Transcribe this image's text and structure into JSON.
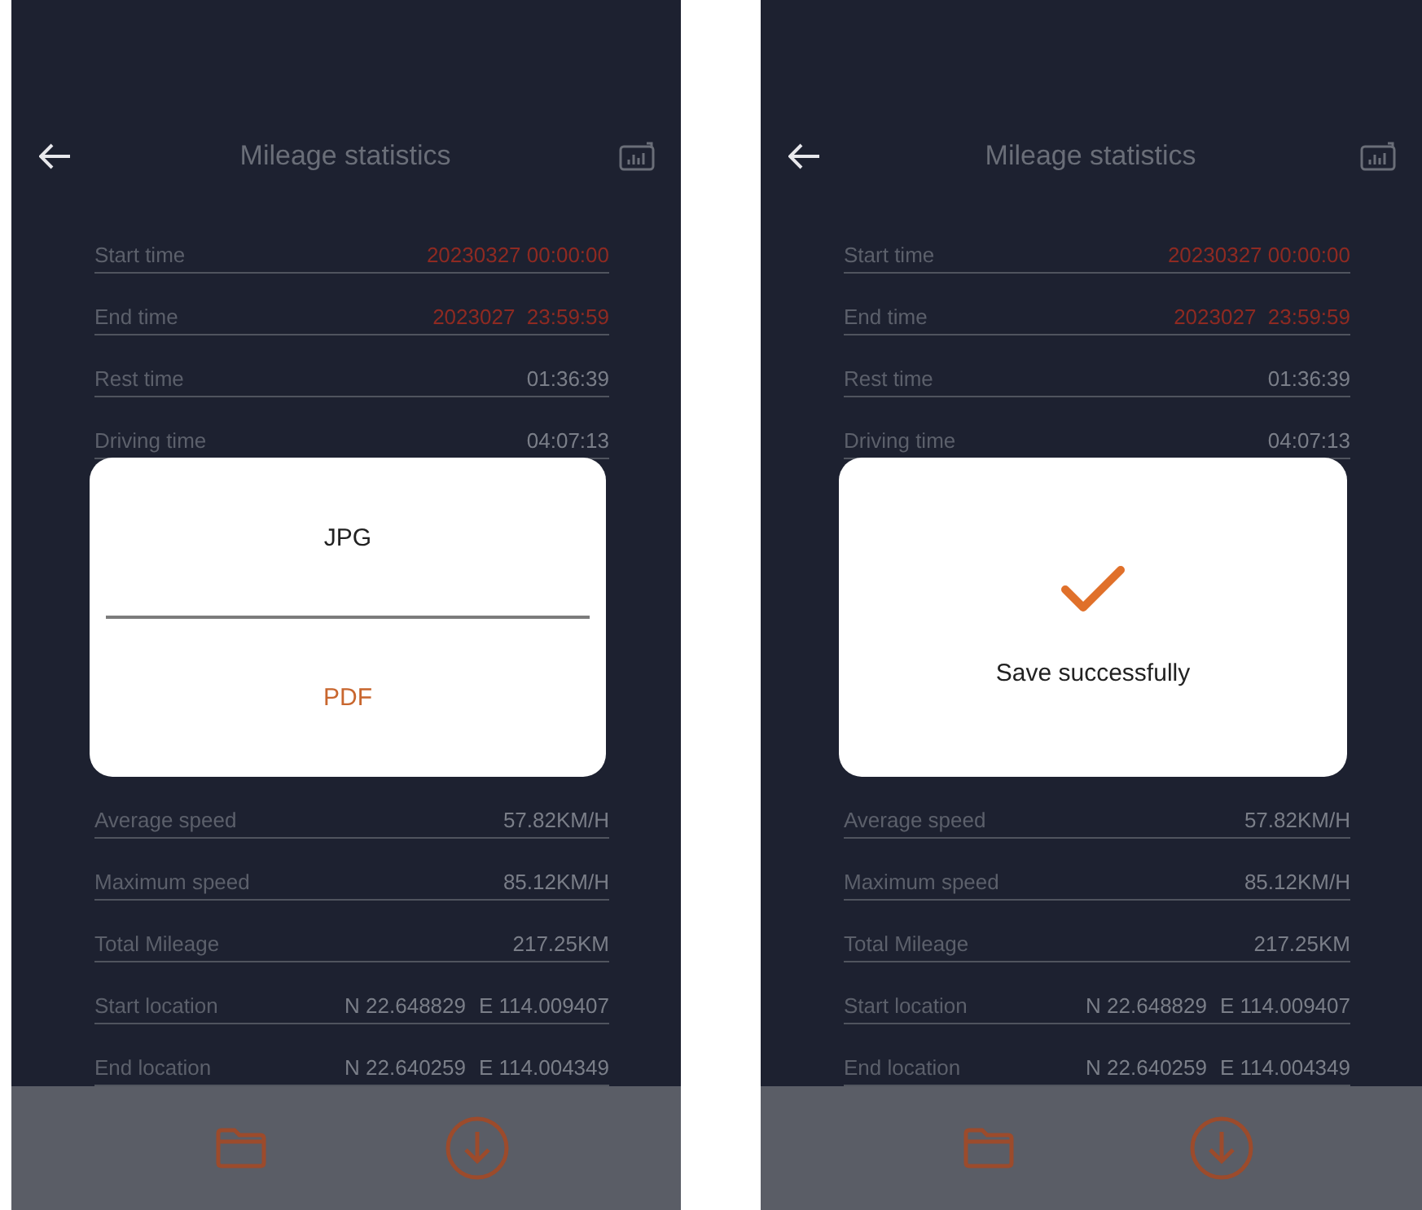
{
  "screens": [
    {
      "title": "Mileage statistics",
      "rows": [
        {
          "label": "Start time",
          "values": [
            "20230327 00:00:00"
          ],
          "highlighted": true
        },
        {
          "label": "End time",
          "values": [
            "2023027  23:59:59"
          ],
          "highlighted": true
        },
        {
          "label": "Rest time",
          "values": [
            "01:36:39"
          ],
          "highlighted": false
        },
        {
          "label": "Driving time",
          "values": [
            "04:07:13"
          ],
          "highlighted": false
        },
        {
          "label": "Average speed",
          "values": [
            "57.82KM/H"
          ],
          "highlighted": false
        },
        {
          "label": "Maximum speed",
          "values": [
            "85.12KM/H"
          ],
          "highlighted": false
        },
        {
          "label": "Total Mileage",
          "values": [
            "217.25KM"
          ],
          "highlighted": false
        },
        {
          "label": "Start location",
          "values": [
            "N 22.648829",
            "E 114.009407"
          ],
          "highlighted": false
        },
        {
          "label": "End location",
          "values": [
            "N 22.640259",
            "E 114.004349"
          ],
          "highlighted": false
        }
      ],
      "dialog": {
        "kind": "choice",
        "options": [
          {
            "label": "JPG",
            "highlighted": false
          },
          {
            "label": "PDF",
            "highlighted": true
          }
        ]
      }
    },
    {
      "title": "Mileage statistics",
      "rows": [
        {
          "label": "Start time",
          "values": [
            "20230327 00:00:00"
          ],
          "highlighted": true
        },
        {
          "label": "End time",
          "values": [
            "2023027  23:59:59"
          ],
          "highlighted": true
        },
        {
          "label": "Rest time",
          "values": [
            "01:36:39"
          ],
          "highlighted": false
        },
        {
          "label": "Driving time",
          "values": [
            "04:07:13"
          ],
          "highlighted": false
        },
        {
          "label": "Average speed",
          "values": [
            "57.82KM/H"
          ],
          "highlighted": false
        },
        {
          "label": "Maximum speed",
          "values": [
            "85.12KM/H"
          ],
          "highlighted": false
        },
        {
          "label": "Total Mileage",
          "values": [
            "217.25KM"
          ],
          "highlighted": false
        },
        {
          "label": "Start location",
          "values": [
            "N 22.648829",
            "E 114.009407"
          ],
          "highlighted": false
        },
        {
          "label": "End location",
          "values": [
            "N 22.640259",
            "E 114.004349"
          ],
          "highlighted": false
        }
      ],
      "dialog": {
        "kind": "toast",
        "message": "Save successfully"
      }
    }
  ]
}
